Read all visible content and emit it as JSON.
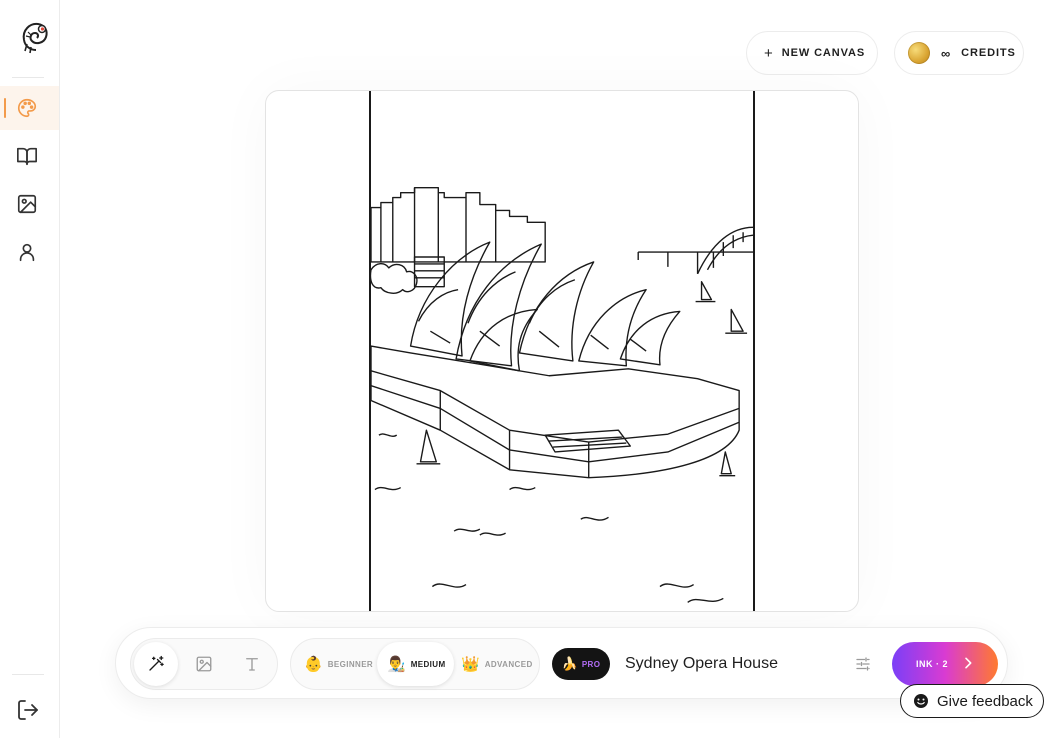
{
  "header": {
    "new_canvas_plus": "+",
    "new_canvas_label": "NEW CANVAS",
    "credits_value": "∞",
    "credits_label": "CREDITS"
  },
  "sidebar": {
    "items": [
      {
        "name": "palette",
        "active": true
      },
      {
        "name": "book",
        "active": false
      },
      {
        "name": "image",
        "active": false
      },
      {
        "name": "user",
        "active": false
      }
    ]
  },
  "toolbar": {
    "levels": [
      {
        "emoji": "👶",
        "label": "BEGINNER"
      },
      {
        "emoji": "👨‍🎨",
        "label": "MEDIUM"
      },
      {
        "emoji": "👑",
        "label": "ADVANCED"
      }
    ],
    "pro_emoji": "🍌",
    "pro_label": "PRO",
    "prompt_value": "Sydney Opera House",
    "ink_label": "INK · 2"
  },
  "feedback": {
    "label": "Give feedback"
  },
  "colors": {
    "accent": "#f39a4a",
    "active_bg": "#fdf4ec",
    "ink_gradient_start": "#7b3ff7",
    "ink_gradient_mid": "#d93bd2",
    "ink_gradient_end": "#ff7a2f",
    "pro_text": "#b26cf5"
  }
}
